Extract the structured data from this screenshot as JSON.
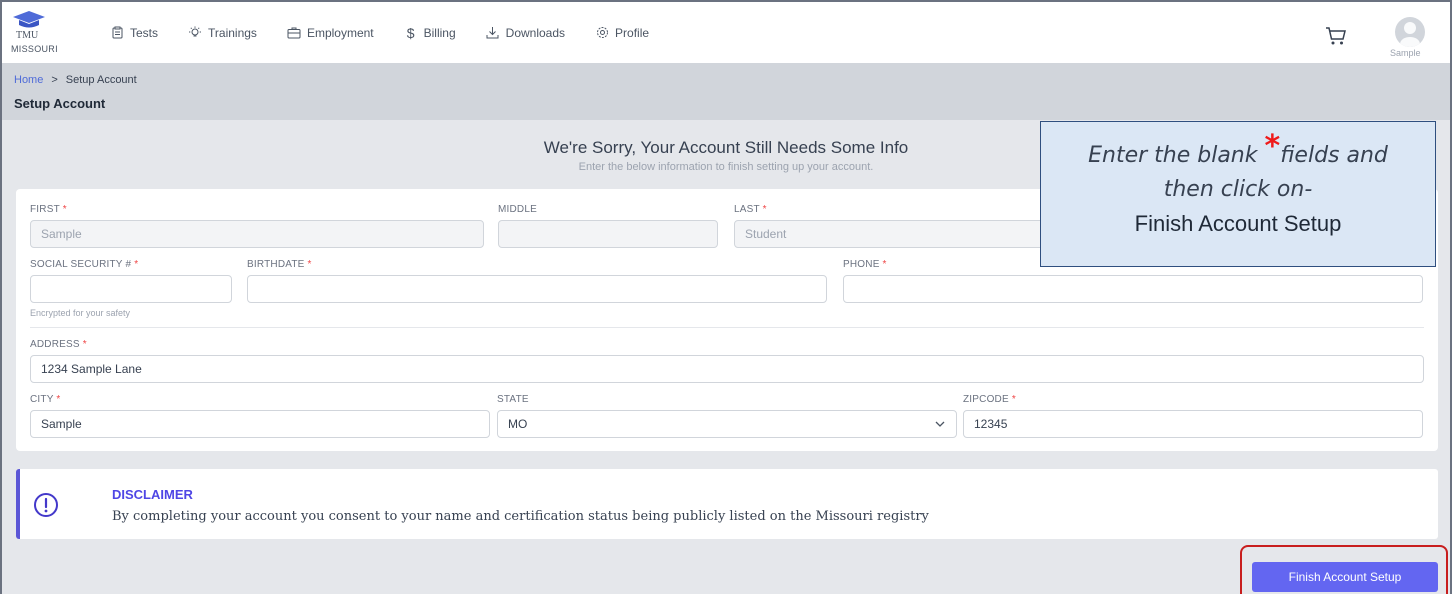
{
  "logo": {
    "line1": "TMU",
    "line2": "MISSOURI"
  },
  "nav": [
    {
      "label": "Tests",
      "icon": "clipboard-icon"
    },
    {
      "label": "Trainings",
      "icon": "lightbulb-icon"
    },
    {
      "label": "Employment",
      "icon": "briefcase-icon"
    },
    {
      "label": "Billing",
      "icon": "dollar-icon"
    },
    {
      "label": "Downloads",
      "icon": "download-icon"
    },
    {
      "label": "Profile",
      "icon": "gear-icon"
    }
  ],
  "user": {
    "name": "Sample"
  },
  "breadcrumb": {
    "home": "Home",
    "separator": ">",
    "current": "Setup Account"
  },
  "page_title": "Setup Account",
  "heading": {
    "title": "We're Sorry, Your Account Still Needs Some Info",
    "subtitle": "Enter the below information to finish setting up your account."
  },
  "form": {
    "first": {
      "label": "FIRST",
      "value": "Sample"
    },
    "middle": {
      "label": "MIDDLE",
      "value": ""
    },
    "last": {
      "label": "LAST",
      "value": "Student"
    },
    "ssn": {
      "label": "SOCIAL SECURITY #",
      "value": "",
      "hint": "Encrypted for your safety"
    },
    "birthdate": {
      "label": "BIRTHDATE",
      "value": ""
    },
    "phone": {
      "label": "PHONE",
      "value": ""
    },
    "address": {
      "label": "ADDRESS",
      "value": "1234 Sample Lane"
    },
    "city": {
      "label": "CITY",
      "value": "Sample"
    },
    "state": {
      "label": "STATE",
      "value": "MO"
    },
    "zipcode": {
      "label": "ZIPCODE",
      "value": "12345"
    },
    "required_mark": "*"
  },
  "callout": {
    "line1_pre": "Enter the blank ",
    "star": "*",
    "line1_post": "fields and",
    "line2": "then click on-",
    "line3": "Finish Account Setup"
  },
  "disclaimer": {
    "title": "DISCLAIMER",
    "body": "By completing your account you consent to your name and certification status being publicly listed on the Missouri registry"
  },
  "finish_button": "Finish Account Setup",
  "colors": {
    "accent": "#6366f1",
    "required": "#ef4444",
    "highlight": "#c81e1e",
    "callout_bg": "#dbe7f5"
  }
}
